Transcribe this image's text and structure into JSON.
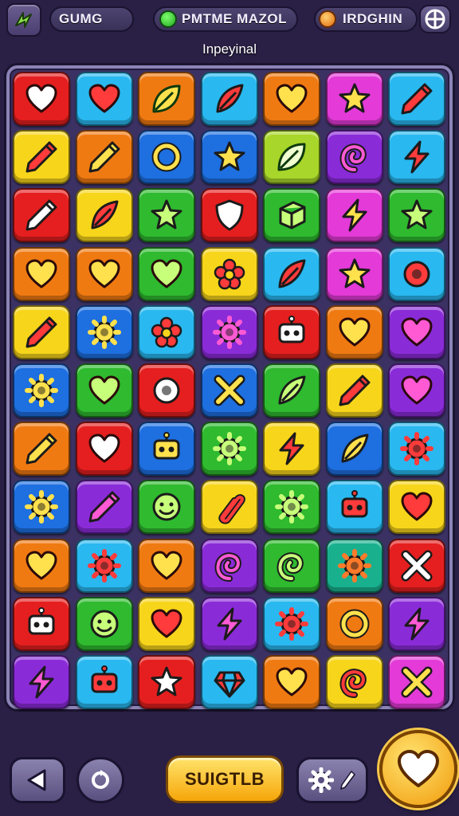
{
  "header": {
    "app_icon": "lightning-leaf-icon",
    "pill_1": "GUMG",
    "pill_2": "PMTME MAZOL",
    "pill_3": "IRDGHIN",
    "plus_icon": "plus-crosshair-icon"
  },
  "subtitle": "Inpeyinal",
  "board": {
    "columns": 7,
    "rows": 11,
    "tiles": [
      [
        "red",
        "heart"
      ],
      [
        "sky",
        "heart"
      ],
      [
        "orange",
        "leaf"
      ],
      [
        "sky",
        "feather"
      ],
      [
        "orange",
        "heart"
      ],
      [
        "magenta",
        "star"
      ],
      [
        "sky",
        "pencil"
      ],
      [
        "yellow",
        "pencil"
      ],
      [
        "orange",
        "pencil"
      ],
      [
        "blue",
        "ring"
      ],
      [
        "blue",
        "star"
      ],
      [
        "lime",
        "leaf"
      ],
      [
        "purple",
        "swirl"
      ],
      [
        "sky",
        "bolt"
      ],
      [
        "red",
        "pencil"
      ],
      [
        "yellow",
        "feather"
      ],
      [
        "green",
        "star"
      ],
      [
        "red",
        "shield"
      ],
      [
        "green",
        "cube"
      ],
      [
        "magenta",
        "bolt"
      ],
      [
        "green",
        "star"
      ],
      [
        "orange",
        "heart"
      ],
      [
        "orange",
        "heart"
      ],
      [
        "green",
        "heart"
      ],
      [
        "yellow",
        "flower"
      ],
      [
        "sky",
        "feather"
      ],
      [
        "magenta",
        "star"
      ],
      [
        "sky",
        "donut"
      ],
      [
        "yellow",
        "pencil"
      ],
      [
        "blue",
        "gear"
      ],
      [
        "sky",
        "flower"
      ],
      [
        "purple",
        "gear"
      ],
      [
        "red",
        "robot"
      ],
      [
        "orange",
        "heart"
      ],
      [
        "purple",
        "heart"
      ],
      [
        "blue",
        "gear"
      ],
      [
        "green",
        "heart"
      ],
      [
        "red",
        "donut"
      ],
      [
        "blue",
        "cross"
      ],
      [
        "green",
        "feather"
      ],
      [
        "yellow",
        "pencil"
      ],
      [
        "purple",
        "heart"
      ],
      [
        "orange",
        "pencil"
      ],
      [
        "red",
        "heart"
      ],
      [
        "blue",
        "robot"
      ],
      [
        "green",
        "gear"
      ],
      [
        "yellow",
        "bolt"
      ],
      [
        "blue",
        "feather"
      ],
      [
        "sky",
        "gear"
      ],
      [
        "blue",
        "gear"
      ],
      [
        "purple",
        "pencil"
      ],
      [
        "green",
        "smile"
      ],
      [
        "yellow",
        "clip"
      ],
      [
        "green",
        "gear"
      ],
      [
        "sky",
        "robot"
      ],
      [
        "yellow",
        "heart"
      ],
      [
        "orange",
        "heart"
      ],
      [
        "sky",
        "gear"
      ],
      [
        "orange",
        "heart"
      ],
      [
        "purple",
        "swirl"
      ],
      [
        "green",
        "swirl"
      ],
      [
        "teal",
        "gear"
      ],
      [
        "red",
        "cross"
      ],
      [
        "red",
        "robot"
      ],
      [
        "green",
        "smile"
      ],
      [
        "yellow",
        "heart"
      ],
      [
        "purple",
        "bolt"
      ],
      [
        "sky",
        "gear"
      ],
      [
        "orange",
        "ring"
      ],
      [
        "purple",
        "bolt"
      ],
      [
        "purple",
        "bolt"
      ],
      [
        "sky",
        "robot"
      ],
      [
        "red",
        "star"
      ],
      [
        "sky",
        "gem"
      ],
      [
        "orange",
        "heart"
      ],
      [
        "yellow",
        "swirl"
      ],
      [
        "magenta",
        "cross"
      ]
    ]
  },
  "footer": {
    "back_icon": "triangle-left-icon",
    "refresh_icon": "refresh-icon",
    "main_label": "SUIGTLB",
    "settings_icon": "gear-icon",
    "edit_icon": "pencil-icon",
    "favorite_icon": "heart-icon"
  },
  "colors": {
    "red": "#e51f1f",
    "sky": "#29b8f0",
    "orange": "#f07a12",
    "magenta": "#e33ad8",
    "yellow": "#f7d51b",
    "blue": "#1e6fe0",
    "lime": "#a8d62a",
    "purple": "#8a2bd8",
    "green": "#2fba2f",
    "teal": "#19b08e"
  }
}
